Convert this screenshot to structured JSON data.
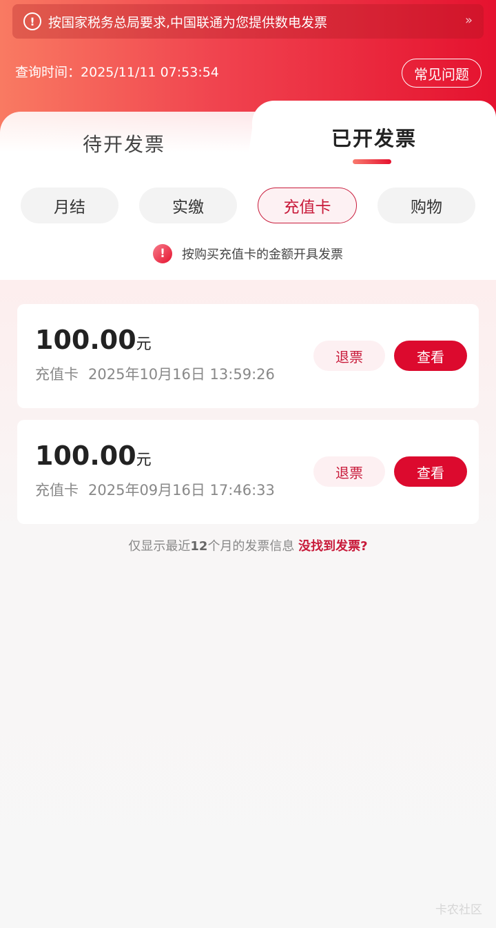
{
  "notice": {
    "text": "按国家税务总局要求,中国联通为您提供数电发票",
    "arrow": "»"
  },
  "header": {
    "query_label": "查询时间：",
    "query_time": "2025/11/11 07:53:54",
    "faq_label": "常见问题"
  },
  "tabs": [
    {
      "label": "待开发票",
      "active": false
    },
    {
      "label": "已开发票",
      "active": true
    }
  ],
  "filters": [
    {
      "label": "月结",
      "active": false
    },
    {
      "label": "实缴",
      "active": false
    },
    {
      "label": "充值卡",
      "active": true
    },
    {
      "label": "购物",
      "active": false
    }
  ],
  "tip": {
    "text": "按购买充值卡的金额开具发票"
  },
  "invoices": [
    {
      "amount": "100.00",
      "unit": "元",
      "type": "充值卡",
      "datetime": "2025年10月16日 13:59:26",
      "refund_label": "退票",
      "view_label": "查看"
    },
    {
      "amount": "100.00",
      "unit": "元",
      "type": "充值卡",
      "datetime": "2025年09月16日 17:46:33",
      "refund_label": "退票",
      "view_label": "查看"
    }
  ],
  "footer": {
    "prefix": "仅显示最近",
    "count": "12",
    "suffix": "个月的发票信息",
    "link": "没找到发票?"
  },
  "watermark": "卡农社区",
  "colors": {
    "accent": "#dc0a2e",
    "header_start": "#f97a62",
    "header_end": "#e5122f"
  }
}
